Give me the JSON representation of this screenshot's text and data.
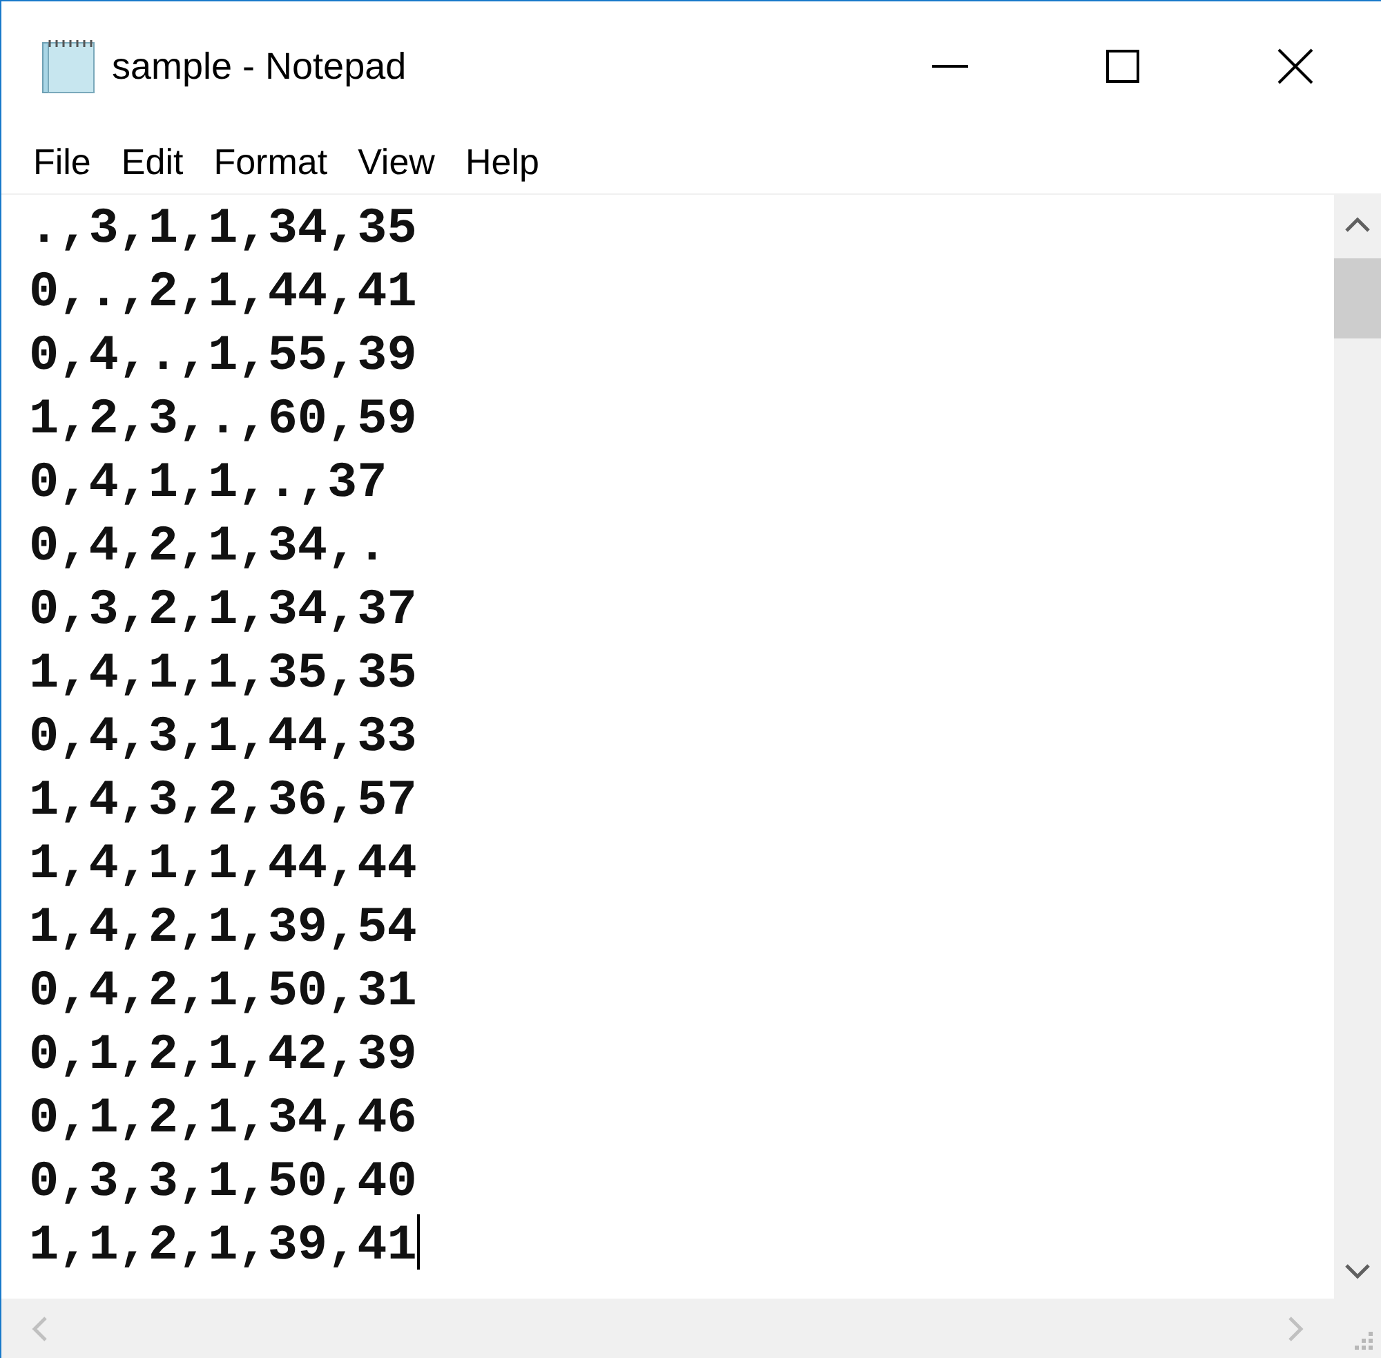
{
  "window": {
    "title": "sample - Notepad"
  },
  "menu": [
    "File",
    "Edit",
    "Format",
    "View",
    "Help"
  ],
  "editor": {
    "lines": [
      {
        "text": ".,3,1,1,34,35",
        "caret": false
      },
      {
        "text": "0,.,2,1,44,41",
        "caret": false
      },
      {
        "text": "0,4,.,1,55,39",
        "caret": false
      },
      {
        "text": "1,2,3,.,60,59",
        "caret": false
      },
      {
        "text": "0,4,1,1,.,37",
        "caret": false
      },
      {
        "text": "0,4,2,1,34,.",
        "caret": false
      },
      {
        "text": "0,3,2,1,34,37",
        "caret": false
      },
      {
        "text": "1,4,1,1,35,35",
        "caret": false
      },
      {
        "text": "0,4,3,1,44,33",
        "caret": false
      },
      {
        "text": "1,4,3,2,36,57",
        "caret": false
      },
      {
        "text": "1,4,1,1,44,44",
        "caret": false
      },
      {
        "text": "1,4,2,1,39,54",
        "caret": false
      },
      {
        "text": "0,4,2,1,50,31",
        "caret": false
      },
      {
        "text": "0,1,2,1,42,39",
        "caret": false
      },
      {
        "text": "0,1,2,1,34,46",
        "caret": false
      },
      {
        "text": "0,3,3,1,50,40",
        "caret": false
      },
      {
        "text": "1,1,2,1,39,41",
        "caret": true
      }
    ]
  }
}
